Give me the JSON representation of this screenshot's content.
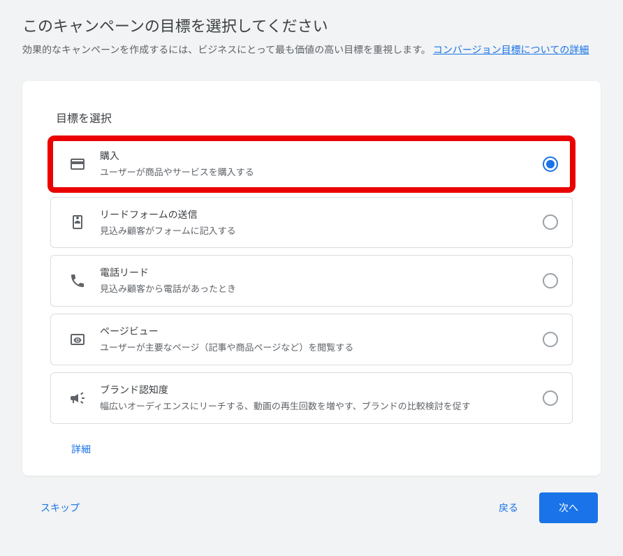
{
  "header": {
    "title": "このキャンペーンの目標を選択してください",
    "subtitle_prefix": "効果的なキャンペーンを作成するには、ビジネスにとって最も価値の高い目標を重視します。",
    "subtitle_link": "コンバージョン目標についての詳細"
  },
  "card": {
    "heading": "目標を選択",
    "details_link": "詳細",
    "options": [
      {
        "icon": "credit-card-icon",
        "title": "購入",
        "desc": "ユーザーが商品やサービスを購入する",
        "selected": true,
        "highlighted": true
      },
      {
        "icon": "contact-form-icon",
        "title": "リードフォームの送信",
        "desc": "見込み顧客がフォームに記入する",
        "selected": false,
        "highlighted": false
      },
      {
        "icon": "phone-icon",
        "title": "電話リード",
        "desc": "見込み顧客から電話があったとき",
        "selected": false,
        "highlighted": false
      },
      {
        "icon": "preview-icon",
        "title": "ページビュー",
        "desc": "ユーザーが主要なページ（記事や商品ページなど）を閲覧する",
        "selected": false,
        "highlighted": false
      },
      {
        "icon": "campaign-icon",
        "title": "ブランド認知度",
        "desc": "幅広いオーディエンスにリーチする、動画の再生回数を増やす、ブランドの比較検討を促す",
        "selected": false,
        "highlighted": false
      }
    ]
  },
  "footer": {
    "skip": "スキップ",
    "back": "戻る",
    "next": "次へ"
  }
}
